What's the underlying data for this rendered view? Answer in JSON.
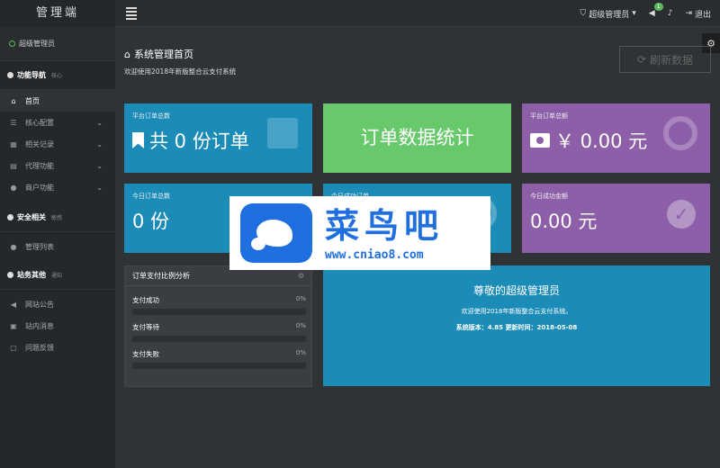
{
  "brand": "管理端",
  "topbar": {
    "user": "超级管理员",
    "notify_badge": "1",
    "logout": "退出"
  },
  "sidebar": {
    "user_label": "超级管理员",
    "sections": [
      {
        "title": "功能导航",
        "sub": "核心"
      },
      {
        "title": "安全相关",
        "sub": "敏感"
      },
      {
        "title": "站务其他",
        "sub": "通知"
      }
    ],
    "items": [
      {
        "label": "首页",
        "icon": "home-icon"
      },
      {
        "label": "核心配置",
        "icon": "sliders-icon"
      },
      {
        "label": "相关记录",
        "icon": "calendar-icon"
      },
      {
        "label": "代理功能",
        "icon": "th-icon"
      },
      {
        "label": "商户功能",
        "icon": "user-icon"
      },
      {
        "label": "管理列表",
        "icon": "users-icon"
      },
      {
        "label": "网站公告",
        "icon": "volume-icon"
      },
      {
        "label": "站内消息",
        "icon": "inbox-icon"
      },
      {
        "label": "问题反馈",
        "icon": "comment-icon"
      }
    ]
  },
  "page": {
    "title": "系统管理首页",
    "subtitle": "欢迎使用2018年新版整合云支付系统",
    "refresh_label": "刷新数据"
  },
  "cards": {
    "total_orders_label": "平台订单总数",
    "total_orders_value": "共 0 份订单",
    "stats_title": "订单数据统计",
    "total_amount_label": "平台订单总额",
    "total_amount_value": "￥ 0.00 元",
    "today_orders_label": "今日订单总数",
    "today_orders_value": "0 份",
    "today_success_label": "今日成功订单",
    "today_amount_label": "今日成功金额",
    "today_amount_value": "0.00 元"
  },
  "pay_panel": {
    "title": "订单支付比例分析",
    "rows": [
      {
        "label": "支付成功",
        "pct": "0%",
        "value": 0
      },
      {
        "label": "支付等待",
        "pct": "0%",
        "value": 0
      },
      {
        "label": "支付失败",
        "pct": "0%",
        "value": 0
      }
    ]
  },
  "welcome": {
    "title": "尊敬的超级管理员",
    "subtitle": "欢迎使用2018年新版整合云支付系统。",
    "version": "系统版本：4.85 更新时间：2018-05-08"
  },
  "watermark": {
    "cn": "菜鸟吧",
    "url": "www.cniao8.com"
  },
  "colors": {
    "blue": "#1b8bb8",
    "green": "#67c96c",
    "purple": "#8d5fa8",
    "brand_blue": "#1f6fe0"
  }
}
